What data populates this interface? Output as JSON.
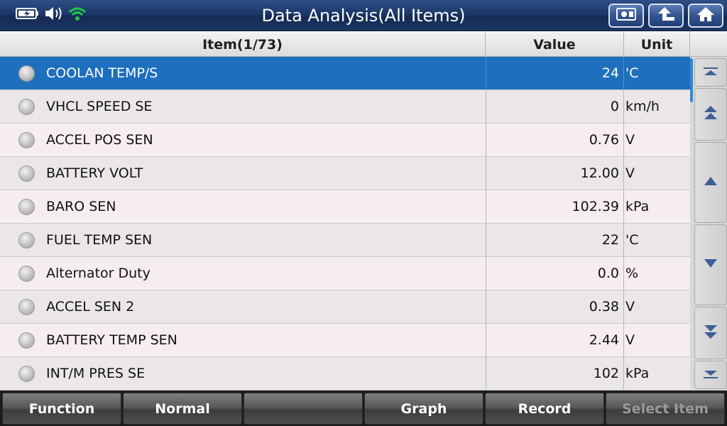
{
  "header": {
    "title": "Data Analysis(All Items)",
    "status_icons": [
      "battery-charging-icon",
      "volume-icon",
      "wifi-icon"
    ],
    "buttons": [
      "screenshot-icon",
      "back-icon",
      "home-icon"
    ]
  },
  "table": {
    "columns": {
      "item": "Item(1/73)",
      "value": "Value",
      "unit": "Unit"
    },
    "rows": [
      {
        "name": "COOLAN TEMP/S",
        "value": "24",
        "unit": "'C",
        "selected": true
      },
      {
        "name": "VHCL SPEED SE",
        "value": "0",
        "unit": "km/h"
      },
      {
        "name": "ACCEL POS SEN",
        "value": "0.76",
        "unit": "V"
      },
      {
        "name": "BATTERY VOLT",
        "value": "12.00",
        "unit": "V"
      },
      {
        "name": "BARO SEN",
        "value": "102.39",
        "unit": "kPa"
      },
      {
        "name": "FUEL TEMP SEN",
        "value": "22",
        "unit": "'C"
      },
      {
        "name": "Alternator Duty",
        "value": "0.0",
        "unit": "%"
      },
      {
        "name": "ACCEL SEN 2",
        "value": "0.38",
        "unit": "V"
      },
      {
        "name": "BATTERY TEMP SEN",
        "value": "2.44",
        "unit": "V"
      },
      {
        "name": "INT/M PRES SE",
        "value": "102",
        "unit": "kPa"
      }
    ]
  },
  "scroll_buttons": [
    "scroll-top-icon",
    "page-up-icon",
    "line-up-icon",
    "line-down-icon",
    "page-down-icon",
    "scroll-bottom-icon"
  ],
  "toolbar": {
    "function_label": "Function",
    "normal_label": "Normal",
    "blank_label": "",
    "graph_label": "Graph",
    "record_label": "Record",
    "select_item_label": "Select Item"
  },
  "colors": {
    "title_bar": "#1d3869",
    "selected_row": "#1e6fbd",
    "wifi": "#22c34a",
    "scroll_indicator": "#2f8ad8"
  }
}
